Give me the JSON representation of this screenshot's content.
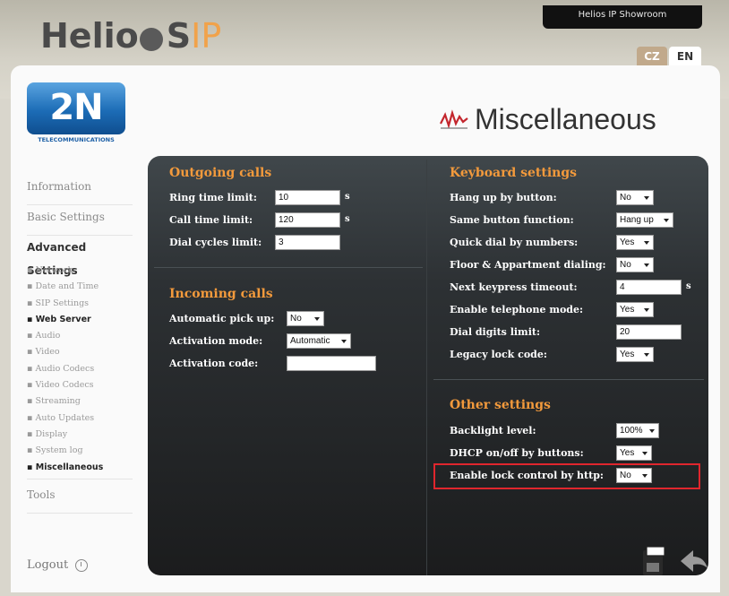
{
  "header": {
    "brand_main": "Helio",
    "brand_s": "S",
    "brand_ip": "IP",
    "showroom": "Helios IP Showroom",
    "lang_cz": "CZ",
    "lang_en": "EN"
  },
  "logo": {
    "text": "2N",
    "sub": "TELECOMMUNICATIONS"
  },
  "page": {
    "title": "Miscellaneous"
  },
  "sidebar": {
    "information": "Information",
    "basic": "Basic Settings",
    "advanced": "Advanced Settings",
    "sub": [
      "Network",
      "Date and Time",
      "SIP Settings",
      "Web Server",
      "Audio",
      "Video",
      "Audio Codecs",
      "Video Codecs",
      "Streaming",
      "Auto Updates",
      "Display",
      "System log",
      "Miscellaneous"
    ],
    "tools": "Tools",
    "logout": "Logout"
  },
  "outgoing": {
    "title": "Outgoing calls",
    "ring_label": "Ring time limit:",
    "ring_value": "10",
    "ring_unit": "s",
    "call_label": "Call time limit:",
    "call_value": "120",
    "call_unit": "s",
    "dial_label": "Dial cycles limit:",
    "dial_value": "3"
  },
  "incoming": {
    "title": "Incoming calls",
    "pickup_label": "Automatic pick up:",
    "pickup_value": "No",
    "activation_label": "Activation mode:",
    "activation_value": "Automatic",
    "code_label": "Activation code:",
    "code_value": ""
  },
  "keyboard": {
    "title": "Keyboard settings",
    "hangup_label": "Hang up by button:",
    "hangup_value": "No",
    "same_label": "Same button function:",
    "same_value": "Hang up",
    "quick_label": "Quick dial by numbers:",
    "quick_value": "Yes",
    "floor_label": "Floor & Appartment dialing:",
    "floor_value": "No",
    "next_label": "Next keypress timeout:",
    "next_value": "4",
    "next_unit": "s",
    "tel_label": "Enable telephone mode:",
    "tel_value": "Yes",
    "dial_label": "Dial digits limit:",
    "dial_value": "20",
    "legacy_label": "Legacy lock code:",
    "legacy_value": "Yes"
  },
  "other": {
    "title": "Other settings",
    "backlight_label": "Backlight level:",
    "backlight_value": "100%",
    "dhcp_label": "DHCP on/off by buttons:",
    "dhcp_value": "Yes",
    "lock_label": "Enable lock control by http:",
    "lock_value": "No"
  },
  "colors": {
    "accent": "#f39a3c",
    "highlight": "#e0262d",
    "brand_blue": "#1c6cb6"
  }
}
